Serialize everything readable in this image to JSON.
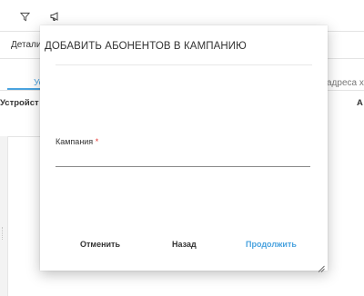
{
  "toolbar": {
    "filter_icon": "filter-icon",
    "campaign_icon": "megaphone-icon"
  },
  "background": {
    "details_header": "Детали",
    "tab_active_label": "Ус",
    "column_devices": "Устройст",
    "column_host_addresses": "адреса хос",
    "column_right_fragment": "А"
  },
  "dialog": {
    "title": "ДОБАВИТЬ АБОНЕНТОВ В КАМПАНИЮ",
    "campaign_label": "Кампания",
    "required_mark": "*",
    "campaign_value": "",
    "cancel_label": "Отменить",
    "back_label": "Назад",
    "continue_label": "Продолжить"
  },
  "colors": {
    "accent": "#4aa3df",
    "required": "#e53935",
    "text": "#333333"
  }
}
